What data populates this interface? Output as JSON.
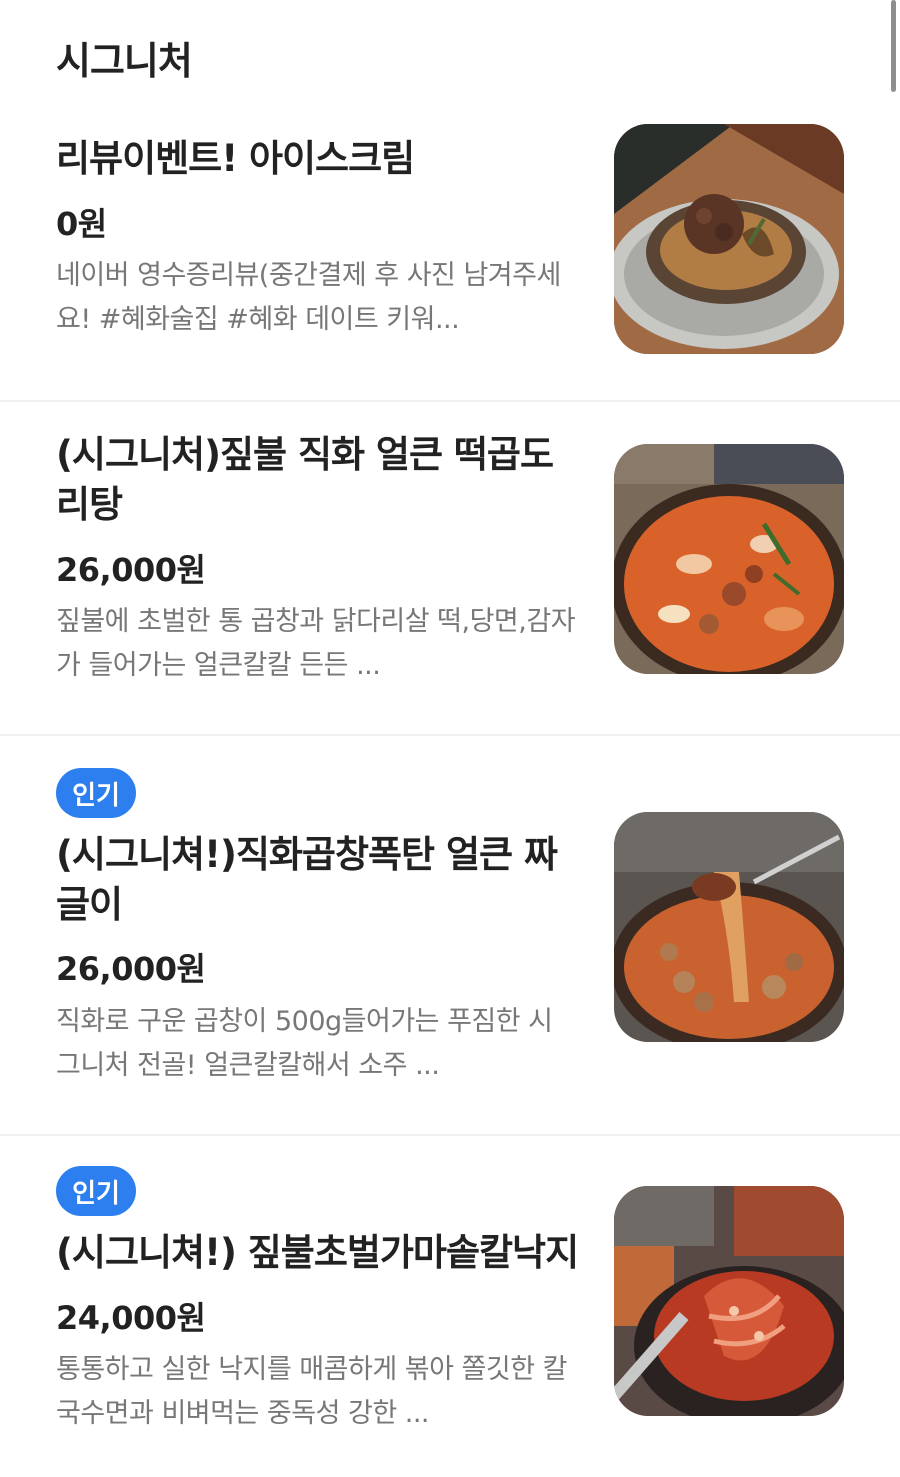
{
  "section": {
    "title": "시그니처"
  },
  "items": [
    {
      "badge": "",
      "name": "리뷰이벤트! 아이스크림",
      "price": "0원",
      "description": "네이버 영수증리뷰(중간결제 후 사진 남겨주세요! #혜화술집 #혜화 데이트 키워...",
      "image": "ice-cream-bowl-photo"
    },
    {
      "badge": "",
      "name": "(시그니처)짚불 직화 얼큰 떡곱도리탕",
      "price": "26,000원",
      "description": "짚불에 초벌한 통 곱창과 닭다리살 떡,당면,감자가 들어가는 얼큰칼칼 든든 ...",
      "image": "tteok-gopdoritang-photo"
    },
    {
      "badge": "인기",
      "name": "(시그니쳐!)직화곱창폭탄 얼큰 짜글이",
      "price": "26,000원",
      "description": "직화로 구운 곱창이 500g들어가는 푸짐한 시그니처 전골! 얼큰칼칼해서 소주 ...",
      "image": "gopchang-jjageuli-photo"
    },
    {
      "badge": "인기",
      "name": "(시그니쳐!) 짚불초벌가마솥칼낙지",
      "price": "24,000원",
      "description": "통통하고 실한 낙지를 매콤하게 볶아 쫄깃한 칼국수면과 비벼먹는 중독성 강한 ...",
      "image": "octopus-kalguksu-photo"
    }
  ]
}
